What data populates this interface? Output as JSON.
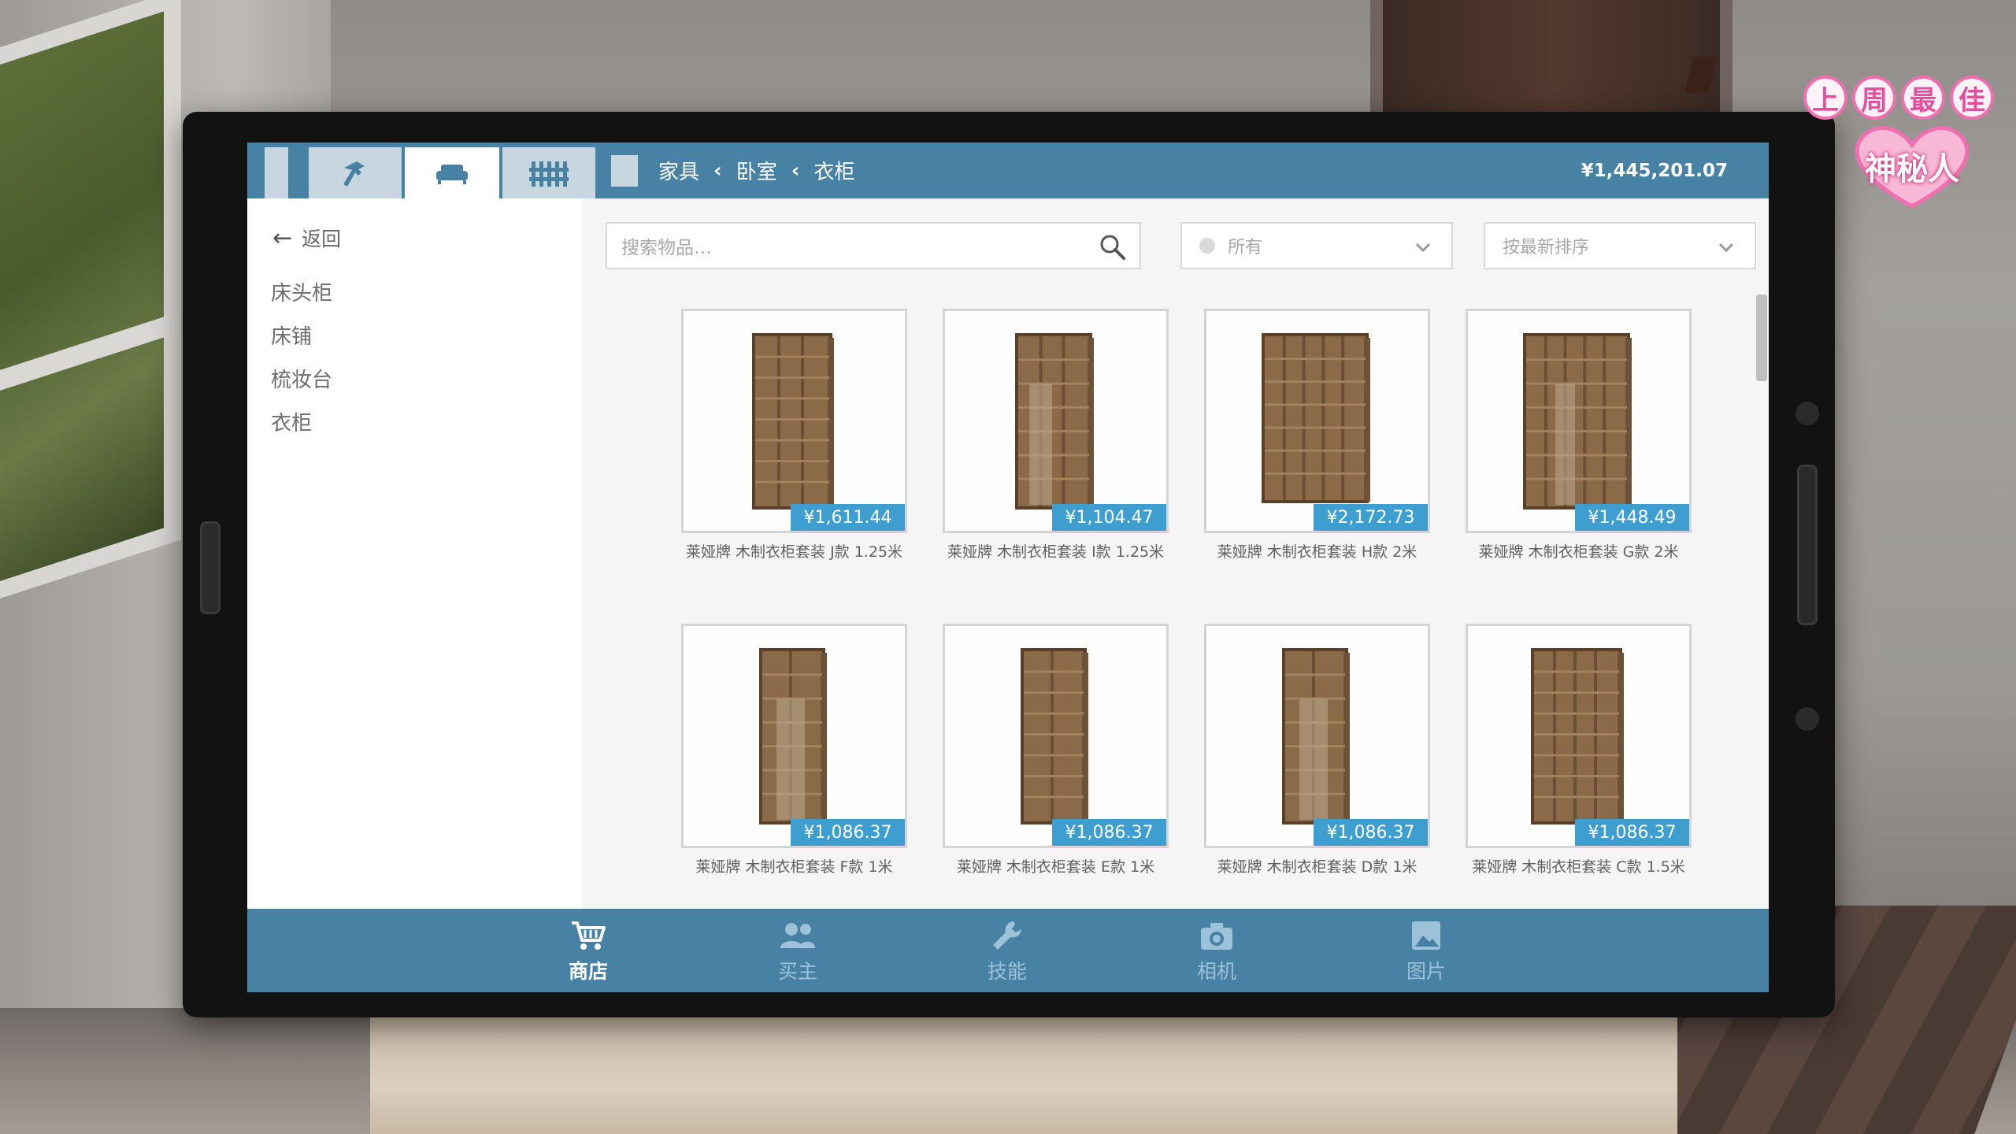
{
  "topbar": {
    "breadcrumb": [
      "家具",
      "卧室",
      "衣柜"
    ],
    "balance": "¥1,445,201.07",
    "tabs": [
      "hammer-icon",
      "sofa-icon",
      "fence-icon"
    ]
  },
  "sidebar": {
    "back_label": "返回",
    "categories": [
      "床头柜",
      "床铺",
      "梳妆台",
      "衣柜"
    ]
  },
  "filters": {
    "search_placeholder": "搜索物品…",
    "category_select": "所有",
    "sort_select": "按最新排序"
  },
  "products": [
    {
      "name": "莱娅牌 木制衣柜套装 J款 1.25米",
      "price": "¥1,611.44"
    },
    {
      "name": "莱娅牌 木制衣柜套装 I款 1.25米",
      "price": "¥1,104.47"
    },
    {
      "name": "莱娅牌 木制衣柜套装 H款 2米",
      "price": "¥2,172.73"
    },
    {
      "name": "莱娅牌 木制衣柜套装 G款 2米",
      "price": "¥1,448.49"
    },
    {
      "name": "莱娅牌 木制衣柜套装 F款 1米",
      "price": "¥1,086.37"
    },
    {
      "name": "莱娅牌 木制衣柜套装 E款 1米",
      "price": "¥1,086.37"
    },
    {
      "name": "莱娅牌 木制衣柜套装 D款 1米",
      "price": "¥1,086.37"
    },
    {
      "name": "莱娅牌 木制衣柜套装 C款 1.5米",
      "price": "¥1,086.37"
    }
  ],
  "bottom_nav": [
    {
      "label": "商店",
      "icon": "cart-icon",
      "active": true
    },
    {
      "label": "买主",
      "icon": "people-icon",
      "active": false
    },
    {
      "label": "技能",
      "icon": "wrench-icon",
      "active": false
    },
    {
      "label": "相机",
      "icon": "camera-icon",
      "active": false
    },
    {
      "label": "图片",
      "icon": "image-icon",
      "active": false
    }
  ],
  "overlay_badge": {
    "top_chars": [
      "上",
      "周",
      "最",
      "佳"
    ],
    "heart_text": "神秘人"
  },
  "colors": {
    "accent": "#4781a4",
    "price_tag": "#3f9ed0",
    "badge_pink": "#f06fb0"
  }
}
